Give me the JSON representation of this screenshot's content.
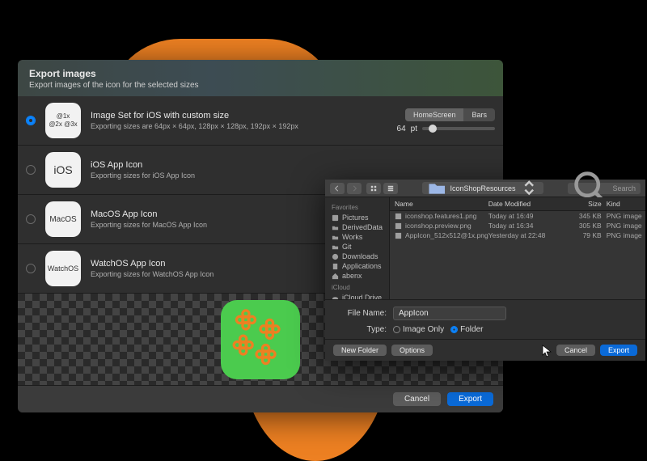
{
  "dialog": {
    "title": "Export images",
    "subtitle": "Export images of the icon for the selected sizes",
    "rows": [
      {
        "thumb": "@1x\n@2x @3x",
        "title": "Image Set for iOS with custom size",
        "sub": "Exporting sizes are  64px × 64px, 128px × 128px, 192px × 192px",
        "selected": true
      },
      {
        "thumb": "iOS",
        "title": "iOS App Icon",
        "sub": "Exporting sizes for iOS App Icon"
      },
      {
        "thumb": "MacOS",
        "title": "MacOS App Icon",
        "sub": "Exporting sizes for MacOS App Icon"
      },
      {
        "thumb": "WatchOS",
        "title": "WatchOS App Icon",
        "sub": "Exporting sizes for WatchOS App Icon"
      }
    ],
    "segment": {
      "a": "HomeScreen",
      "b": "Bars"
    },
    "size_value": "64",
    "size_unit": "pt",
    "cancel": "Cancel",
    "export": "Export"
  },
  "sheet": {
    "location": "IconShopResources",
    "search_placeholder": "Search",
    "fav_header": "Favorites",
    "favorites": [
      "Pictures",
      "DerivedData",
      "Works",
      "Git",
      "Downloads",
      "Applications",
      "abenx"
    ],
    "icloud_header": "iCloud",
    "icloud": [
      "iCloud Drive"
    ],
    "columns": {
      "name": "Name",
      "date": "Date Modified",
      "size": "Size",
      "kind": "Kind"
    },
    "files": [
      {
        "name": "iconshop.features1.png",
        "date": "Today at 16:49",
        "size": "345 KB",
        "kind": "PNG image"
      },
      {
        "name": "iconshop.preview.png",
        "date": "Today at 16:34",
        "size": "305 KB",
        "kind": "PNG image"
      },
      {
        "name": "AppIcon_512x512@1x.png",
        "date": "Yesterday at 22:48",
        "size": "79 KB",
        "kind": "PNG image"
      }
    ],
    "filename_label": "File Name:",
    "filename_value": "AppIcon",
    "type_label": "Type:",
    "type_image": "Image Only",
    "type_folder": "Folder",
    "new_folder": "New Folder",
    "options": "Options",
    "cancel": "Cancel",
    "export": "Export"
  }
}
